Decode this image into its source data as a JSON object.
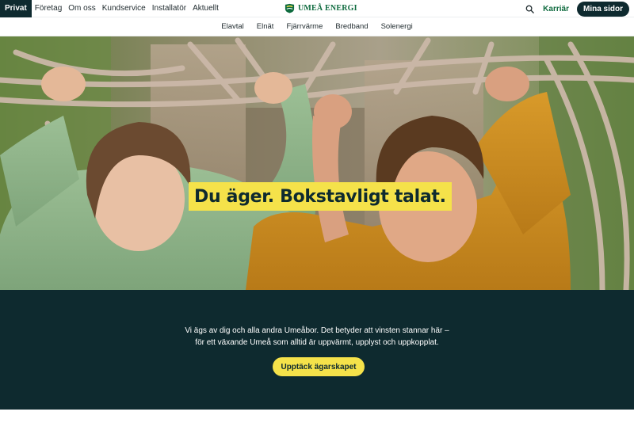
{
  "topnav": {
    "segments": [
      "Privat",
      "Företag",
      "Om oss",
      "Kundservice",
      "Installatör",
      "Aktuellt"
    ],
    "active": "Privat",
    "brand": "UMEÅ ENERGI",
    "search_icon": "search-icon",
    "careers": "Karriär",
    "my_pages": "Mina sidor"
  },
  "subnav": {
    "items": [
      "Elavtal",
      "Elnät",
      "Fjärrvärme",
      "Bredband",
      "Solenergi"
    ]
  },
  "hero": {
    "headline": "Du äger. Bokstavligt talat."
  },
  "ownership": {
    "line1": "Vi ägs av dig och alla andra Umeåbor. Det betyder att vinsten stannar här –",
    "line2": "för ett växande Umeå som alltid är uppvärmt, upplyst och uppkopplat.",
    "cta": "Upptäck ägarskapet"
  },
  "colors": {
    "dark": "#0e2a2f",
    "yellow": "#f5e24a",
    "brand_green": "#0f6b3f"
  }
}
